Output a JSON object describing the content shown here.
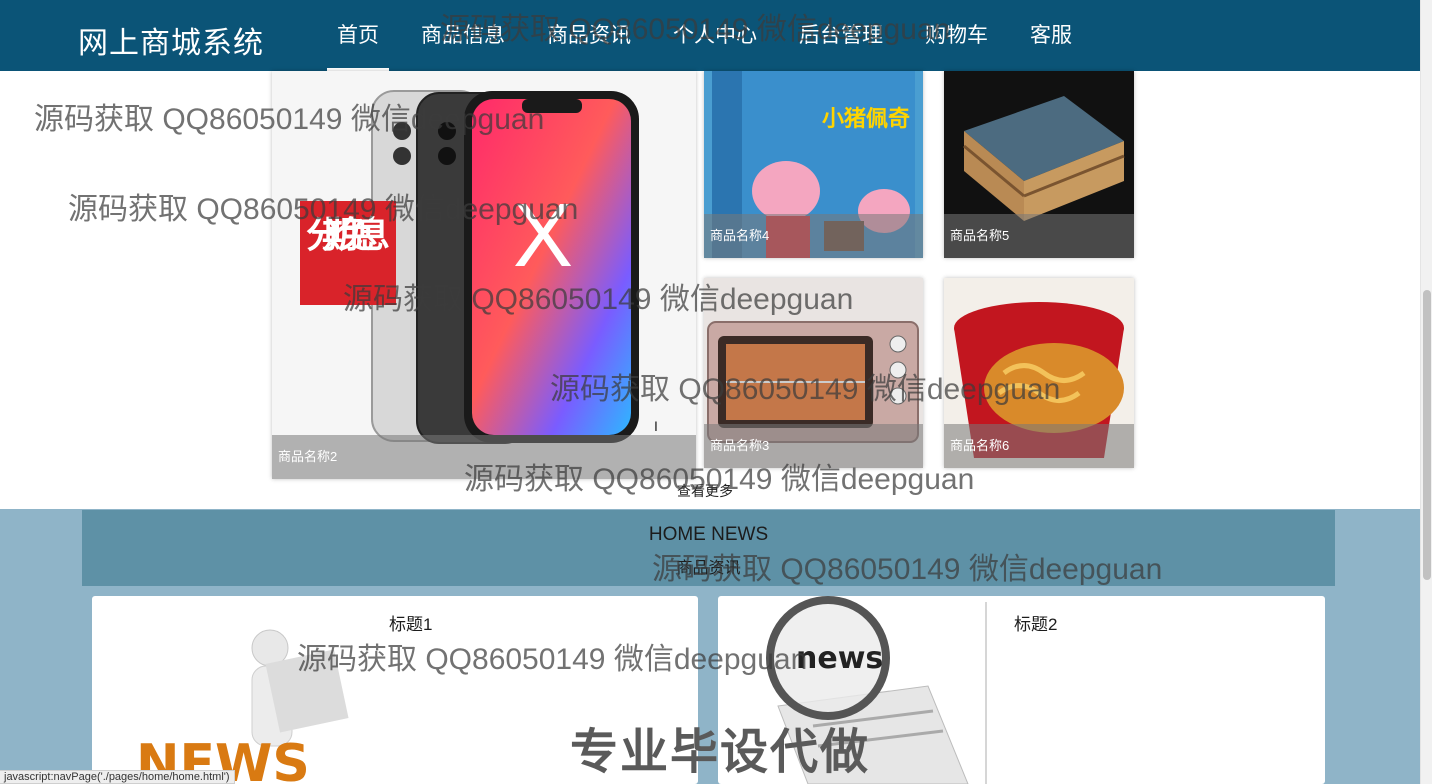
{
  "header": {
    "logo": "网上商城系统",
    "nav": [
      "首页",
      "商品信息",
      "商品资讯",
      "个人中心",
      "后台管理",
      "购物车",
      "客服"
    ],
    "bg_color": "#0b5477"
  },
  "products": {
    "big": {
      "name": "商品名称2"
    },
    "p4": {
      "name": "商品名称4"
    },
    "p5": {
      "name": "商品名称5"
    },
    "p3": {
      "name": "商品名称3"
    },
    "p6": {
      "name": "商品名称6"
    },
    "more_label": "查看更多",
    "image_labels": {
      "promo": "分期免息",
      "phone_mark": "X",
      "book_title": "小猪佩奇"
    }
  },
  "news": {
    "heading_en": "HOME NEWS",
    "heading_cn": "商品资讯",
    "cards": [
      {
        "title": "标题1",
        "image_text": "NEWS"
      },
      {
        "title": "标题2",
        "image_text": "news"
      }
    ]
  },
  "watermark": "源码获取 QQ86050149 微信deepguan",
  "watermark_big": "专业毕设代做",
  "status_bar": "javascript:navPage('./pages/home/home.html')"
}
